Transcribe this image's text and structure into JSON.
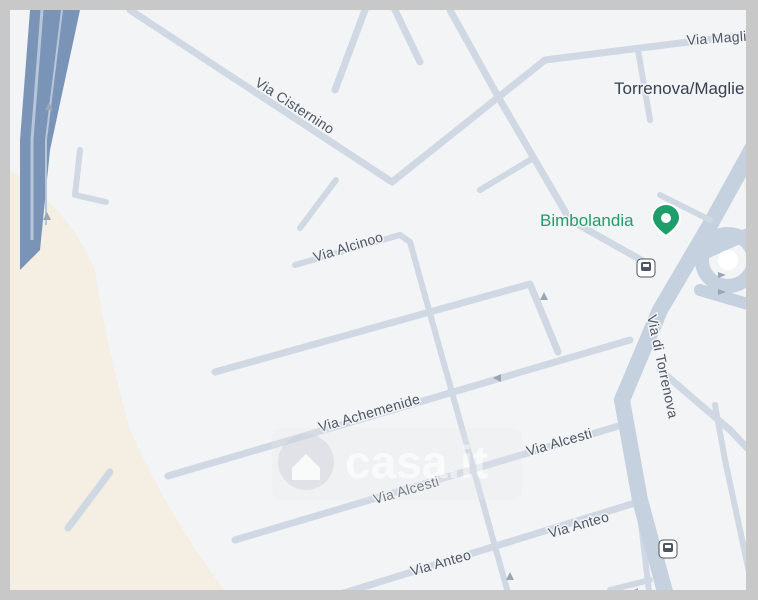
{
  "map": {
    "area_label": "Torrenova/Maglie",
    "poi": {
      "name": "Bimbolandia",
      "icon": "map-pin-icon",
      "color": "#1f9d6b"
    },
    "streets": {
      "via_magli": "Via Magli",
      "via_cisternino": "Via Cisternino",
      "via_alcinoo": "Via Alcinoo",
      "via_achemenide": "Via Achemenide",
      "via_alcesti_lower": "Via Alcesti",
      "via_alcesti_upper": "Via Alcesti",
      "via_anteo_upper": "Via Anteo",
      "via_anteo_lower": "Via Anteo",
      "via_di_torrenova": "Via di Torrenova"
    },
    "transit_icons": [
      "bus-stop-icon",
      "bus-stop-icon",
      "bus-stop-icon"
    ],
    "colors": {
      "land": "#f3f4f6",
      "road": "#cfd8e3",
      "sand": "#f4eee3",
      "water": "#7a94b8"
    }
  },
  "watermark": {
    "text": "casa.it"
  }
}
